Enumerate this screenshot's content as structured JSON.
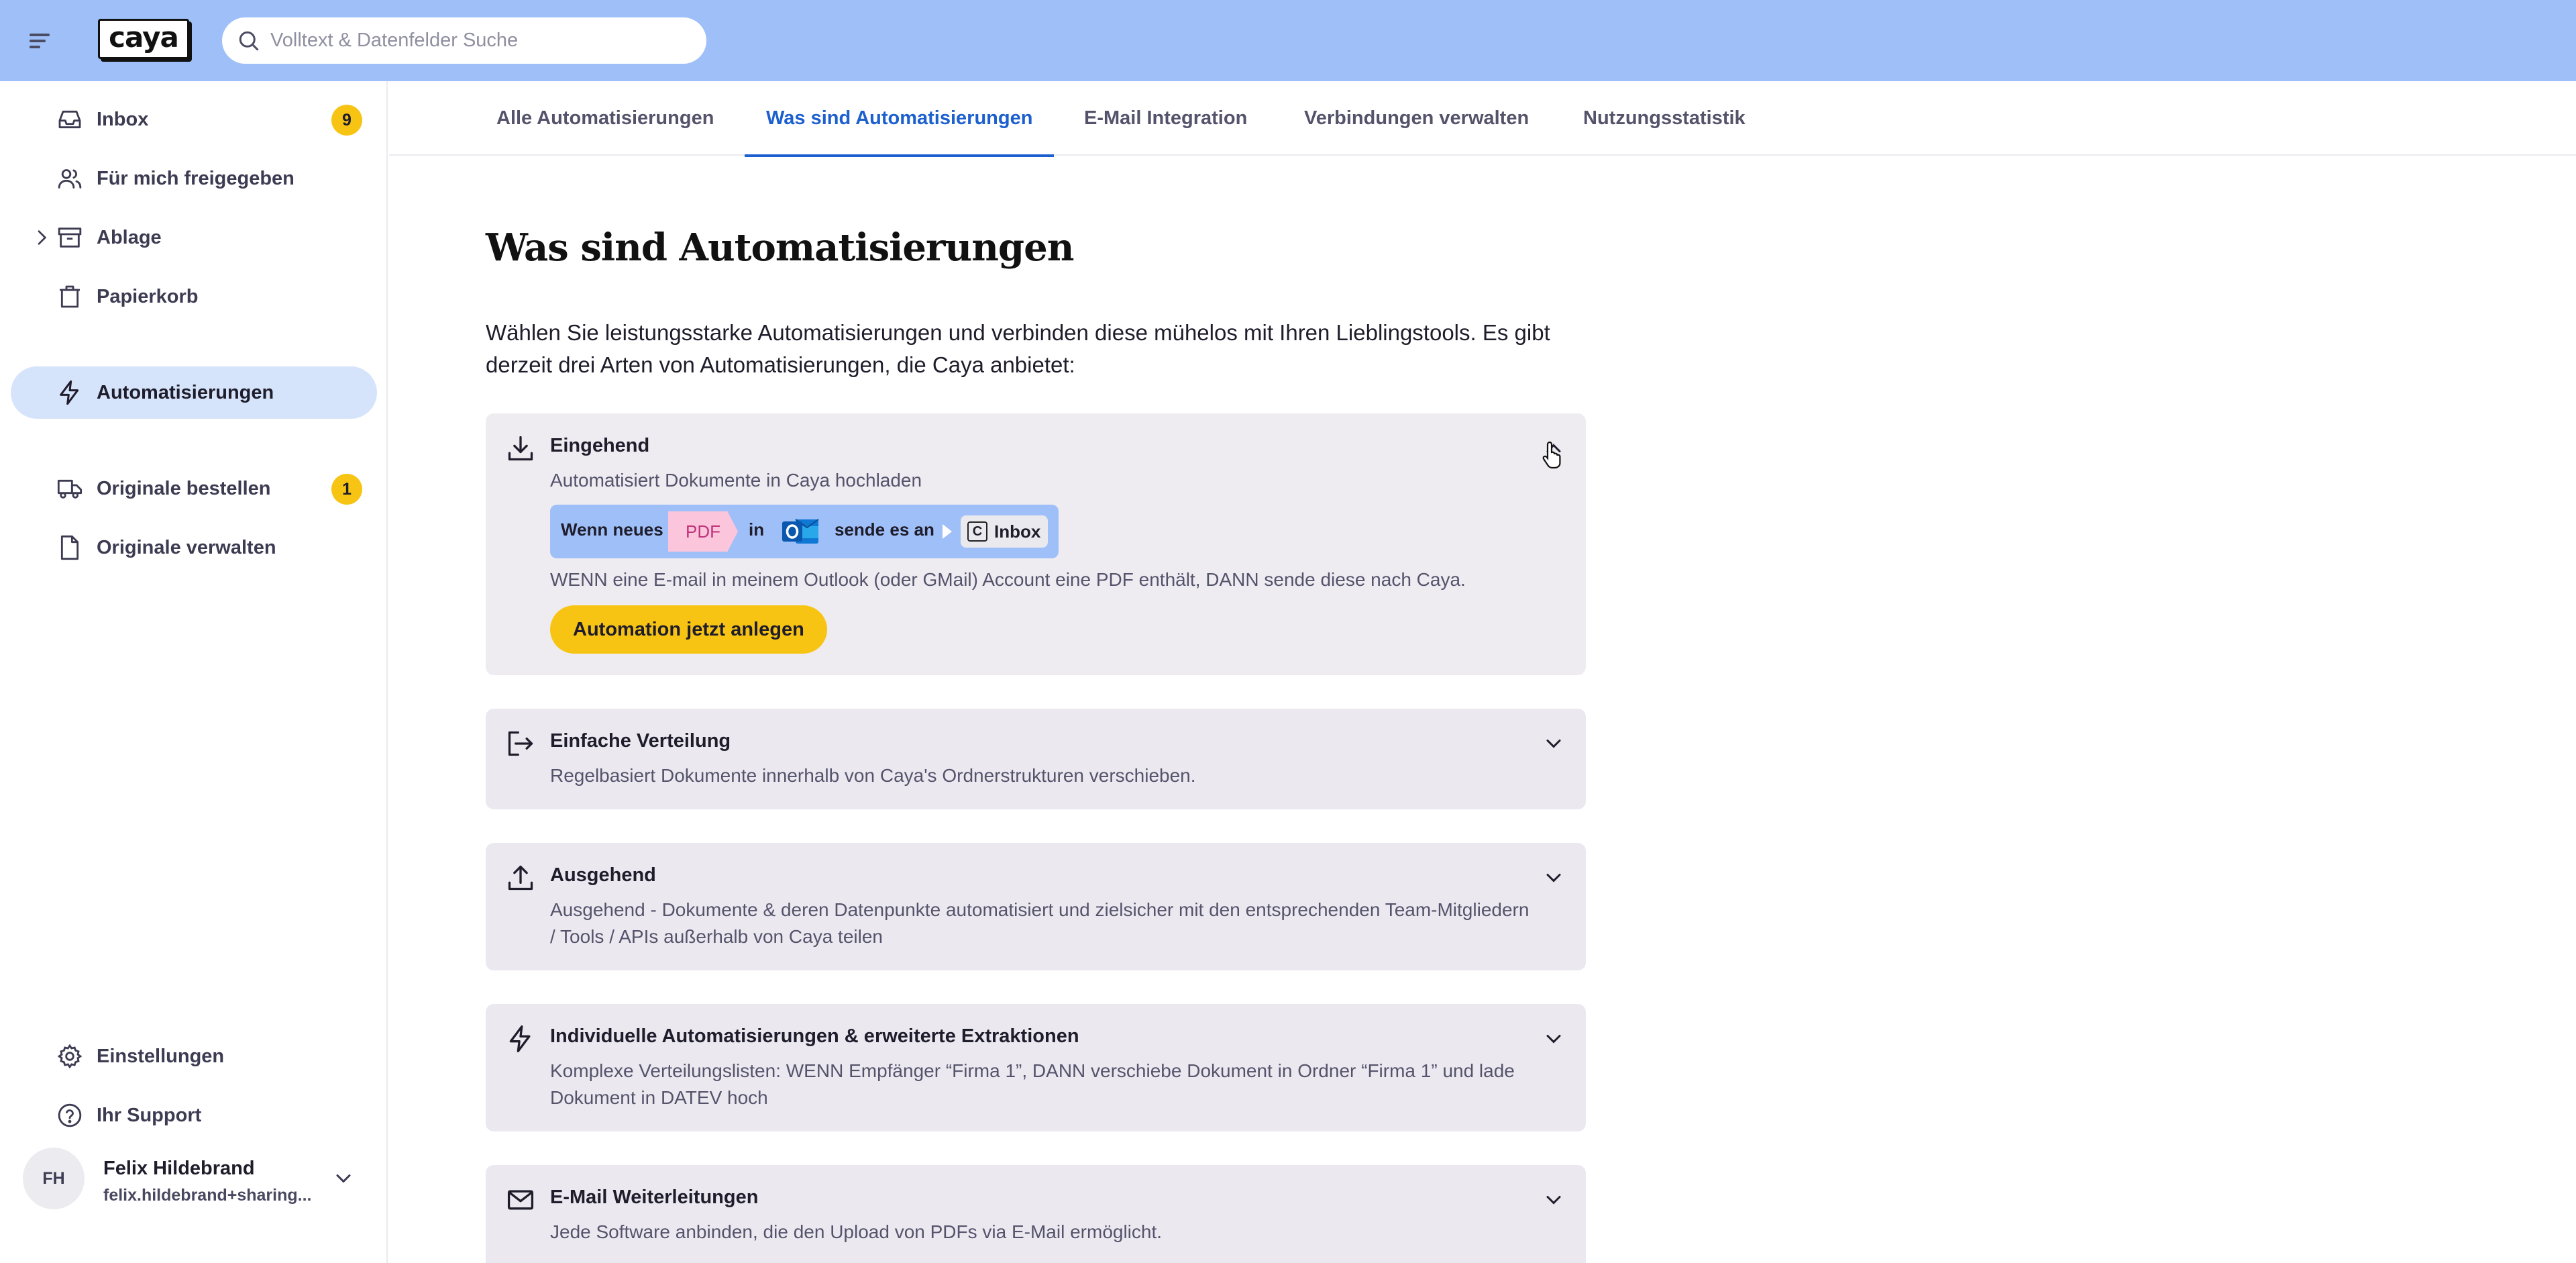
{
  "header": {
    "logo_text": "caya",
    "search_placeholder": "Volltext & Datenfelder Suche"
  },
  "sidebar": {
    "items": [
      {
        "label": "Inbox",
        "icon": "inbox-icon",
        "badge": "9"
      },
      {
        "label": "Für mich freigegeben",
        "icon": "users-icon"
      },
      {
        "label": "Ablage",
        "icon": "archive-icon"
      },
      {
        "label": "Papierkorb",
        "icon": "trash-icon"
      },
      {
        "label": "Automatisierungen",
        "icon": "lightning-icon",
        "active": true
      },
      {
        "label": "Originale bestellen",
        "icon": "truck-icon",
        "badge": "1"
      },
      {
        "label": "Originale verwalten",
        "icon": "document-icon"
      }
    ],
    "bottom": [
      {
        "label": "Einstellungen",
        "icon": "gear-icon"
      },
      {
        "label": "Ihr Support",
        "icon": "help-icon"
      }
    ],
    "user": {
      "initials": "FH",
      "name": "Felix Hildebrand",
      "email": "felix.hildebrand+sharing..."
    }
  },
  "tabs": [
    {
      "label": "Alle Automatisierungen"
    },
    {
      "label": "Was sind Automatisierungen",
      "active": true
    },
    {
      "label": "E-Mail Integration"
    },
    {
      "label": "Verbindungen verwalten"
    },
    {
      "label": "Nutzungsstatistik"
    }
  ],
  "main": {
    "title": "Was sind Automatisierungen",
    "intro": "Wählen Sie leistungsstarke Automatisierungen und verbinden diese mühelos mit Ihren Lieblingstools. Es gibt derzeit drei Arten von Automatisierungen, die Caya anbietet:",
    "cards": [
      {
        "title": "Eingehend",
        "description": "Automatisiert Dokumente in Caya hochladen",
        "expanded": true,
        "flow": {
          "when_new": "Wenn neues",
          "file_type": "PDF",
          "in": "in",
          "send_to": "sende es an",
          "target": "Inbox",
          "target_icon_letter": "C"
        },
        "flow_description": "WENN eine E-mail in meinem Outlook (oder GMail) Account eine PDF enthält, DANN sende diese nach Caya.",
        "cta": "Automation jetzt anlegen"
      },
      {
        "title": "Einfache Verteilung",
        "description": "Regelbasiert Dokumente innerhalb von Caya's Ordnerstrukturen verschieben."
      },
      {
        "title": "Ausgehend",
        "description": "Ausgehend - Dokumente & deren Datenpunkte automatisiert und zielsicher mit den entsprechenden Team-Mitgliedern / Tools / APIs außerhalb von Caya teilen"
      },
      {
        "title": "Individuelle Automatisierungen & erweiterte Extraktionen",
        "description": "Komplexe Verteilungslisten: WENN Empfänger “Firma 1”, DANN verschiebe Dokument in Ordner “Firma 1” und lade Dokument in DATEV hoch"
      },
      {
        "title": "E-Mail Weiterleitungen",
        "description": "Jede Software anbinden, die den Upload von PDFs via E-Mail ermöglicht."
      }
    ]
  },
  "colors": {
    "topbar": "#9fbff8",
    "accent_blue": "#1c5fcf",
    "badge_yellow": "#f7c414",
    "active_nav": "#d6e4fb",
    "card_bg": "#ebe9ef",
    "pdf_pink": "#fbc5dc"
  }
}
